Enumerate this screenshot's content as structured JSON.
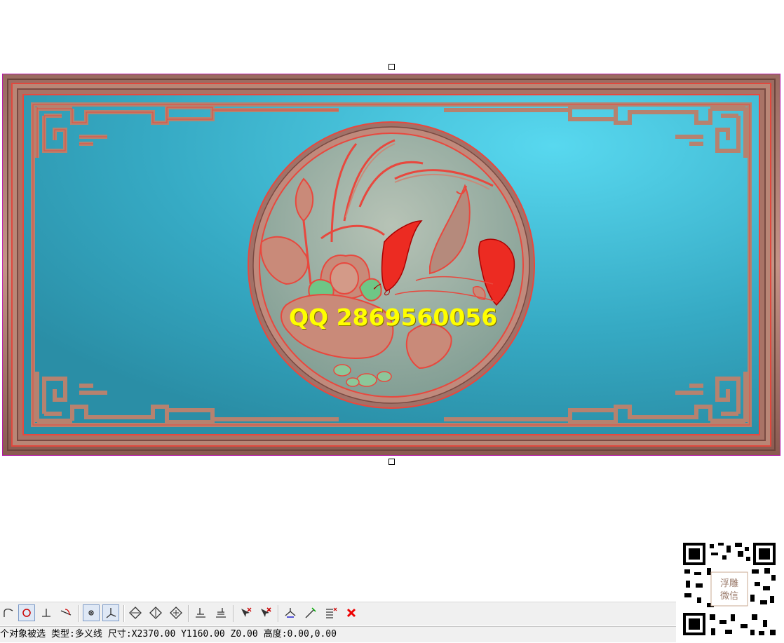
{
  "panel": {
    "description": "carved relief rectangular panel, lotus and koi fish in roundel",
    "colors": {
      "frame": "#b88373",
      "frame_dark": "#7e5048",
      "outline": "#e8483e",
      "field": "#33a7c1",
      "field_light": "#55d3ea",
      "medallion": "#9bb3a7",
      "fish": "#ec2b22",
      "leaf": "#c98a79",
      "bud": "#6fc686",
      "selection": "#c000c0"
    }
  },
  "watermark": {
    "text": "QQ 2869560056"
  },
  "toolbar": {
    "buttons": [
      {
        "name": "arc-icon",
        "pressed": false
      },
      {
        "name": "circle-snap-icon",
        "pressed": true
      },
      {
        "name": "perpendicular-icon",
        "pressed": false
      },
      {
        "name": "tangent-icon",
        "pressed": false
      },
      {
        "name": "center-snap-icon",
        "pressed": true
      },
      {
        "name": "angle-icon",
        "pressed": true
      },
      {
        "name": "node-add-icon",
        "pressed": false
      },
      {
        "name": "node-remove-icon",
        "pressed": false
      },
      {
        "name": "node-move-icon",
        "pressed": false
      },
      {
        "name": "align-left-icon",
        "pressed": false
      },
      {
        "name": "align-right-icon",
        "pressed": false
      },
      {
        "name": "select-add-icon",
        "pressed": false
      },
      {
        "name": "select-remove-icon",
        "pressed": false
      },
      {
        "name": "transform-icon",
        "pressed": false
      },
      {
        "name": "edit-node-icon",
        "pressed": false
      },
      {
        "name": "list-edit-icon",
        "pressed": false
      },
      {
        "name": "delete-icon",
        "pressed": false
      }
    ]
  },
  "status": {
    "selected": "个对象被选",
    "type": "类型:多义线",
    "size": "尺寸:X2370.00 Y1160.00 Z0.00",
    "height": "高度:0.00,0.00"
  },
  "qr": {
    "label_top": "浮雕",
    "label_bottom": "微信"
  }
}
